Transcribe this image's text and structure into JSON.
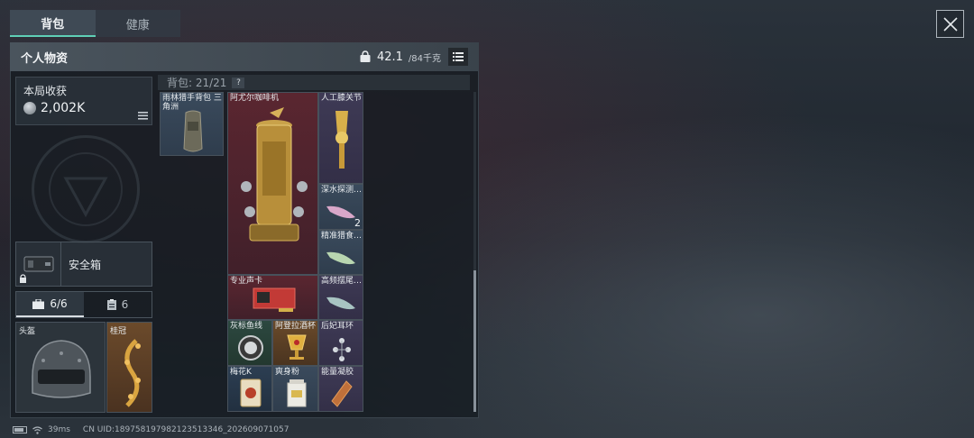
{
  "tabs": [
    {
      "label": "背包",
      "active": true
    },
    {
      "label": "健康",
      "active": false
    }
  ],
  "panel": {
    "title": "个人物资",
    "weight_value": "42.1",
    "weight_capacity": "/84千克"
  },
  "harvest": {
    "label": "本局收获",
    "value": "2,002K"
  },
  "safe_box": {
    "label": "安全箱"
  },
  "equipment_tabs": [
    {
      "count": "6/6",
      "icon": "briefcase-icon",
      "active": true
    },
    {
      "count": "6",
      "icon": "clipboard-icon",
      "active": false
    }
  ],
  "equipment_slots": {
    "helmet_label": "头盔",
    "crown_label": "桂冠"
  },
  "backpack": {
    "label": "背包: 21/21",
    "help": "?"
  },
  "items": [
    {
      "name": "雨林猎手背包 三角洲",
      "rarity": "blue"
    },
    {
      "name": "阿尤尔咖啡机",
      "rarity": "red"
    },
    {
      "name": "人工膝关节",
      "rarity": "purple"
    },
    {
      "name": "深水探测… S",
      "rarity": "blue",
      "count": "2"
    },
    {
      "name": "精准猎食… S",
      "rarity": "blue"
    },
    {
      "name": "专业声卡",
      "rarity": "red"
    },
    {
      "name": "高频摆尾… A",
      "rarity": "purple"
    },
    {
      "name": "灰标鱼线",
      "rarity": "green"
    },
    {
      "name": "阿登拉酒杯",
      "rarity": "gold"
    },
    {
      "name": "后妃耳环",
      "rarity": "purple"
    },
    {
      "name": "梅花K",
      "rarity": "navy"
    },
    {
      "name": "爽身粉",
      "rarity": "blue"
    },
    {
      "name": "能量凝胶",
      "rarity": "purple"
    }
  ],
  "status_bar": {
    "ping": "39ms",
    "uid": "CN UID:18975819798212351334​6_20260907105​7"
  },
  "colors": {
    "accent": "#5fd0b6",
    "red_rarity": "#5a2630",
    "gold_rarity": "#6a4a2a"
  }
}
